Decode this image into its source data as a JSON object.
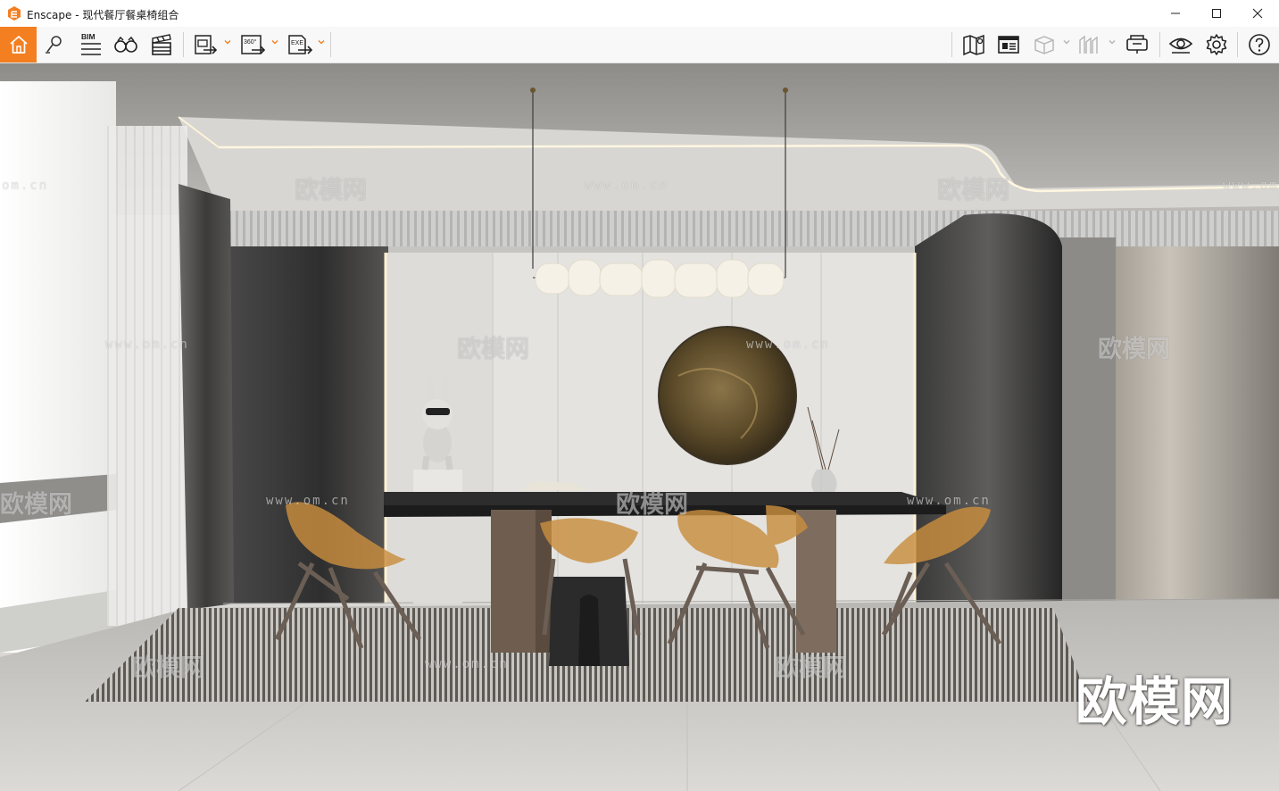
{
  "window": {
    "app_name": "Enscape",
    "separator": " - ",
    "document_name": "现代餐厅餐桌椅组合",
    "controls": {
      "minimize_icon": "minimize-icon",
      "maximize_icon": "maximize-icon",
      "close_icon": "close-icon"
    }
  },
  "toolbar": {
    "accent_color": "#f47f20",
    "left_tools": [
      {
        "name": "home",
        "icon": "home-icon"
      },
      {
        "name": "views",
        "icon": "map-pin-icon"
      },
      {
        "name": "bim",
        "icon": "bim-icon",
        "label": "BIM"
      },
      {
        "name": "visual-settings",
        "icon": "binoculars-icon"
      },
      {
        "name": "video-editor",
        "icon": "clapperboard-icon"
      },
      {
        "name": "screenshot",
        "icon": "screenshot-export-icon"
      },
      {
        "name": "panorama",
        "icon": "panorama-export-icon",
        "label": "360°"
      },
      {
        "name": "exe-export",
        "icon": "exe-export-icon",
        "label": "EXE"
      }
    ],
    "right_tools": [
      {
        "name": "map",
        "icon": "map-icon"
      },
      {
        "name": "asset-library",
        "icon": "asset-library-icon"
      },
      {
        "name": "material-cube",
        "icon": "cube-icon"
      },
      {
        "name": "site-context",
        "icon": "site-context-icon"
      },
      {
        "name": "vr-headset",
        "icon": "vr-headset-icon"
      },
      {
        "name": "visibility",
        "icon": "eye-icon"
      },
      {
        "name": "settings",
        "icon": "gear-icon"
      },
      {
        "name": "help",
        "icon": "help-icon"
      }
    ],
    "collapse_icon": "chevron-up-icon"
  },
  "viewport": {
    "scene": "render-viewport",
    "watermark_big": "欧模网",
    "watermark_url": "www.om.cn",
    "watermark_url_short": "om.cn",
    "watermark_cn": "欧模网"
  }
}
